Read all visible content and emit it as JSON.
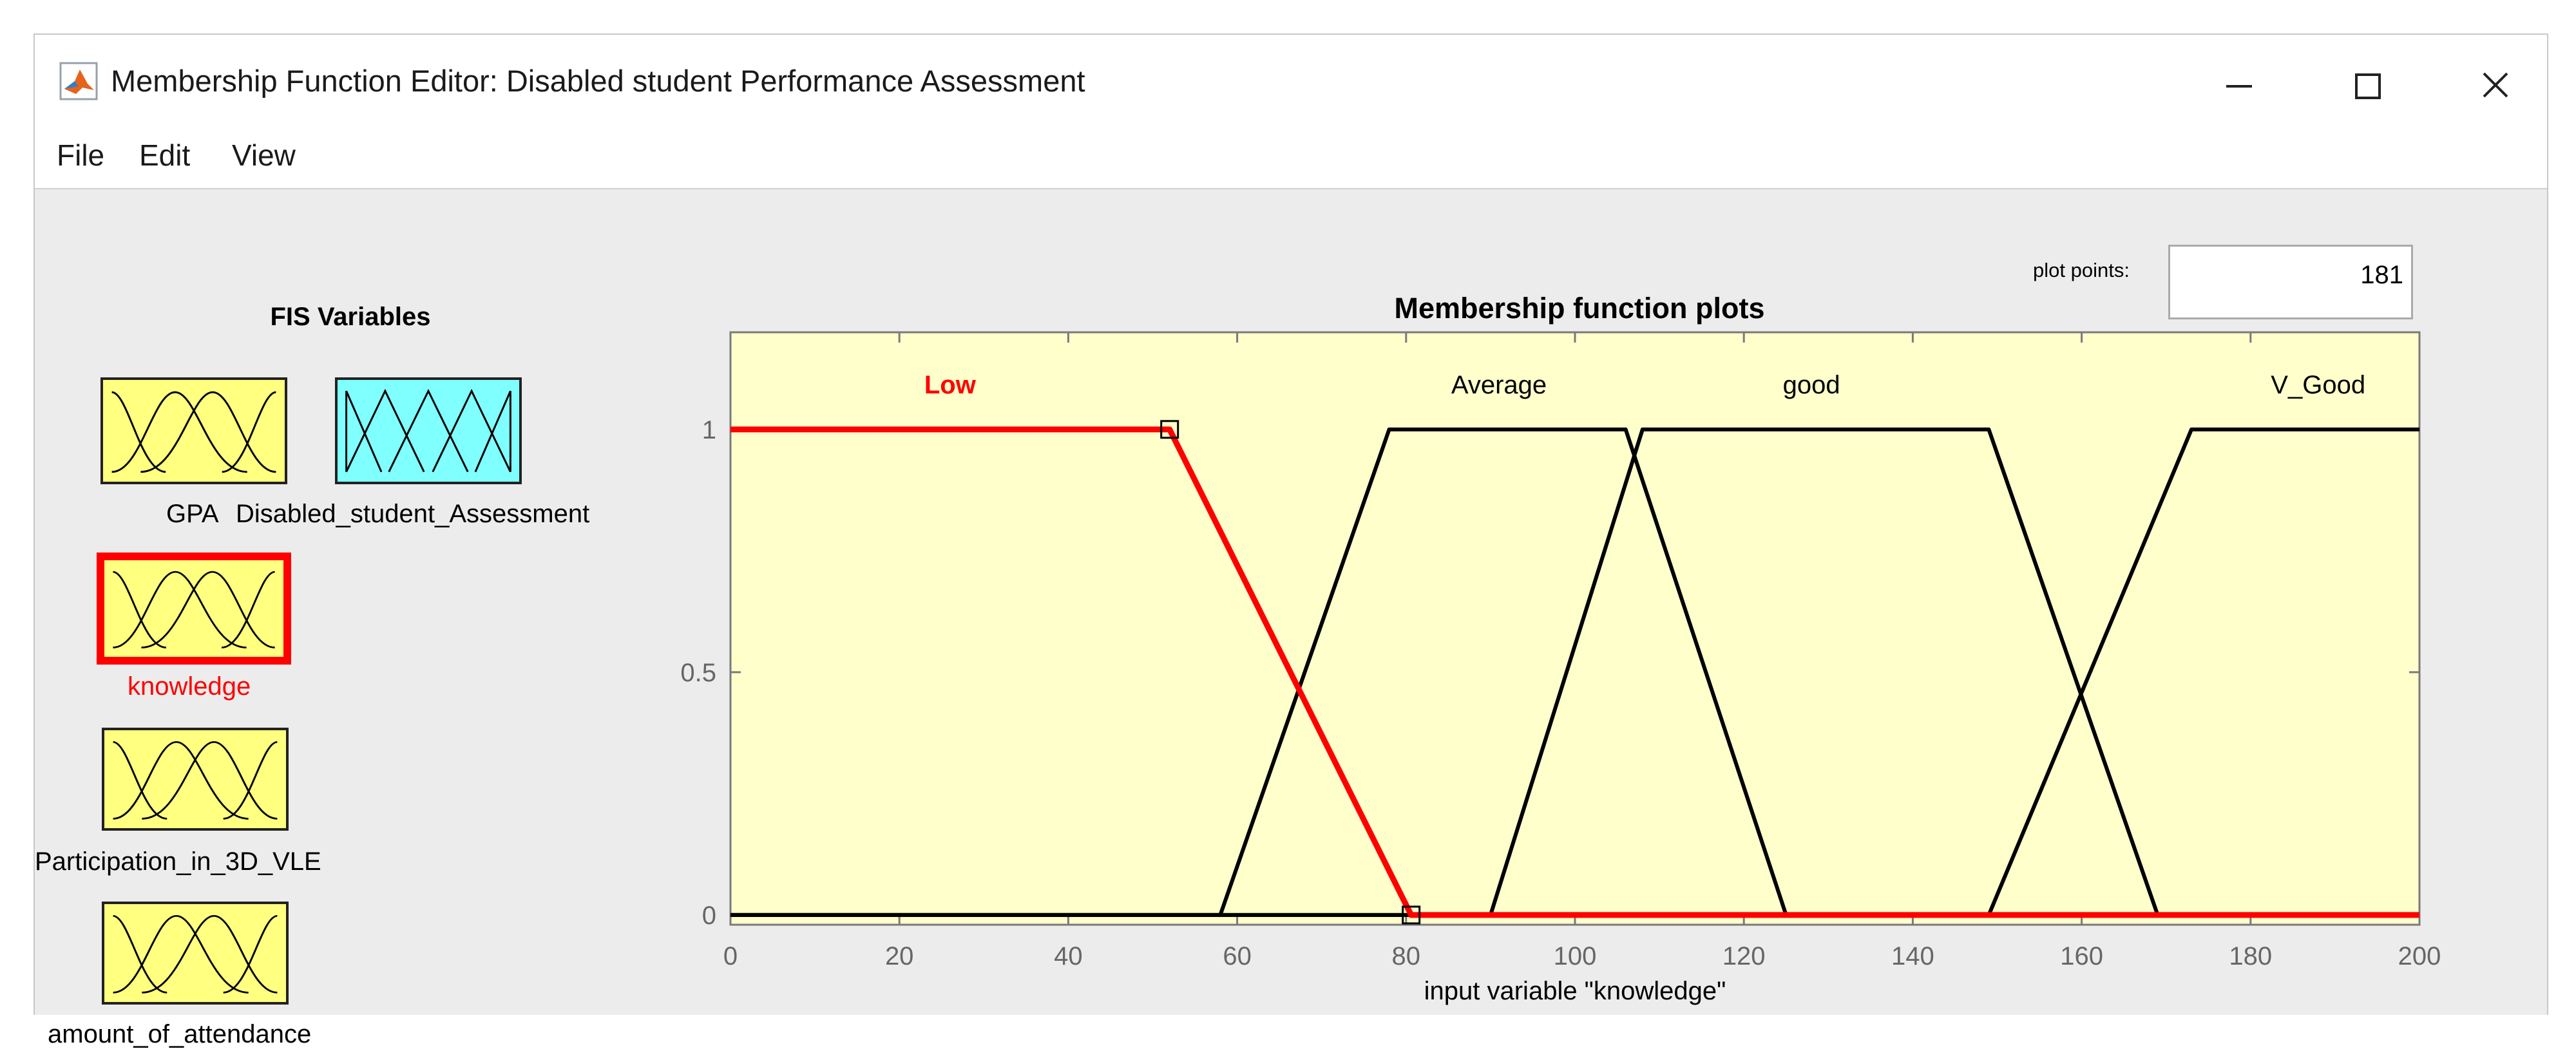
{
  "window": {
    "title": "Membership Function Editor: Disabled student Performance Assessment",
    "app_icon": "matlab-icon",
    "controls": [
      "minimize-icon",
      "maximize-icon",
      "close-icon"
    ]
  },
  "menu": {
    "items": [
      "File",
      "Edit",
      "View"
    ]
  },
  "fis_panel": {
    "title": "FIS Variables",
    "variables": [
      {
        "label": "GPA",
        "kind": "input",
        "selected": false
      },
      {
        "label": "Disabled_student_Assessment",
        "kind": "output",
        "selected": false
      },
      {
        "label": "knowledge",
        "kind": "input",
        "selected": true
      },
      {
        "label": "Participation_in_3D_VLE",
        "kind": "input",
        "selected": false
      },
      {
        "label": "amount_of_attendance",
        "kind": "input",
        "selected": false
      }
    ],
    "colors": {
      "input_fill": "#ffff80",
      "output_fill": "#80ffff",
      "selected_border": "#ff0000"
    }
  },
  "plot_points": {
    "label": "plot points:",
    "value": "181"
  },
  "chart_data": {
    "type": "line",
    "title": "Membership function plots",
    "xlabel": "input variable \"knowledge\"",
    "ylabel": "",
    "xlim": [
      0,
      200
    ],
    "ylim": [
      -0.02,
      1.2
    ],
    "xticks": [
      0,
      20,
      40,
      60,
      80,
      100,
      120,
      140,
      160,
      180,
      200
    ],
    "yticks": [
      0,
      0.5,
      1
    ],
    "background": "#ffffcc",
    "grid": false,
    "series": [
      {
        "name": "Low",
        "color": "#ff0000",
        "selected": true,
        "label_x": 26,
        "points": [
          [
            0,
            1
          ],
          [
            52,
            1
          ],
          [
            80.6,
            0
          ],
          [
            200,
            0
          ]
        ]
      },
      {
        "name": "Average",
        "color": "#000000",
        "selected": false,
        "label_x": 91,
        "points": [
          [
            0,
            0
          ],
          [
            58,
            0
          ],
          [
            78,
            1
          ],
          [
            106,
            1
          ],
          [
            125,
            0
          ],
          [
            200,
            0
          ]
        ]
      },
      {
        "name": "good",
        "color": "#000000",
        "selected": false,
        "label_x": 128,
        "points": [
          [
            0,
            0
          ],
          [
            90,
            0
          ],
          [
            108,
            1
          ],
          [
            149,
            1
          ],
          [
            169,
            0
          ],
          [
            200,
            0
          ]
        ]
      },
      {
        "name": "V_Good",
        "color": "#000000",
        "selected": false,
        "label_x": 188,
        "points": [
          [
            0,
            0
          ],
          [
            149,
            0
          ],
          [
            173,
            1
          ],
          [
            200,
            1
          ]
        ]
      }
    ],
    "markers": [
      [
        52,
        1
      ],
      [
        80.6,
        0
      ]
    ]
  }
}
